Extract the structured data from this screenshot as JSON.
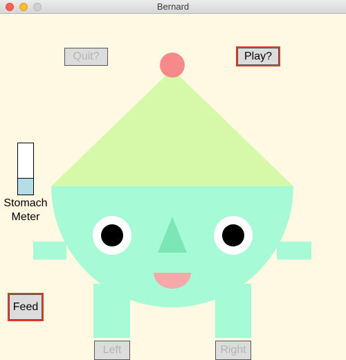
{
  "window": {
    "title": "Bernard"
  },
  "buttons": {
    "quit": "Quit?",
    "play": "Play?",
    "feed": "Feed",
    "left": "Left",
    "right": "Right"
  },
  "stomach_meter": {
    "label_line1": "Stomach",
    "label_line2": "Meter",
    "fill_fraction": 0.33
  },
  "colors": {
    "background": "#fff8e2",
    "body": "#a6fbd6",
    "hat": "#d6f9a9",
    "pompom": "#f78989",
    "mouth": "#f5a9a9",
    "nose": "#7de6b6",
    "meter_fill": "#b4dde8",
    "button_highlight": "#e03a22"
  }
}
